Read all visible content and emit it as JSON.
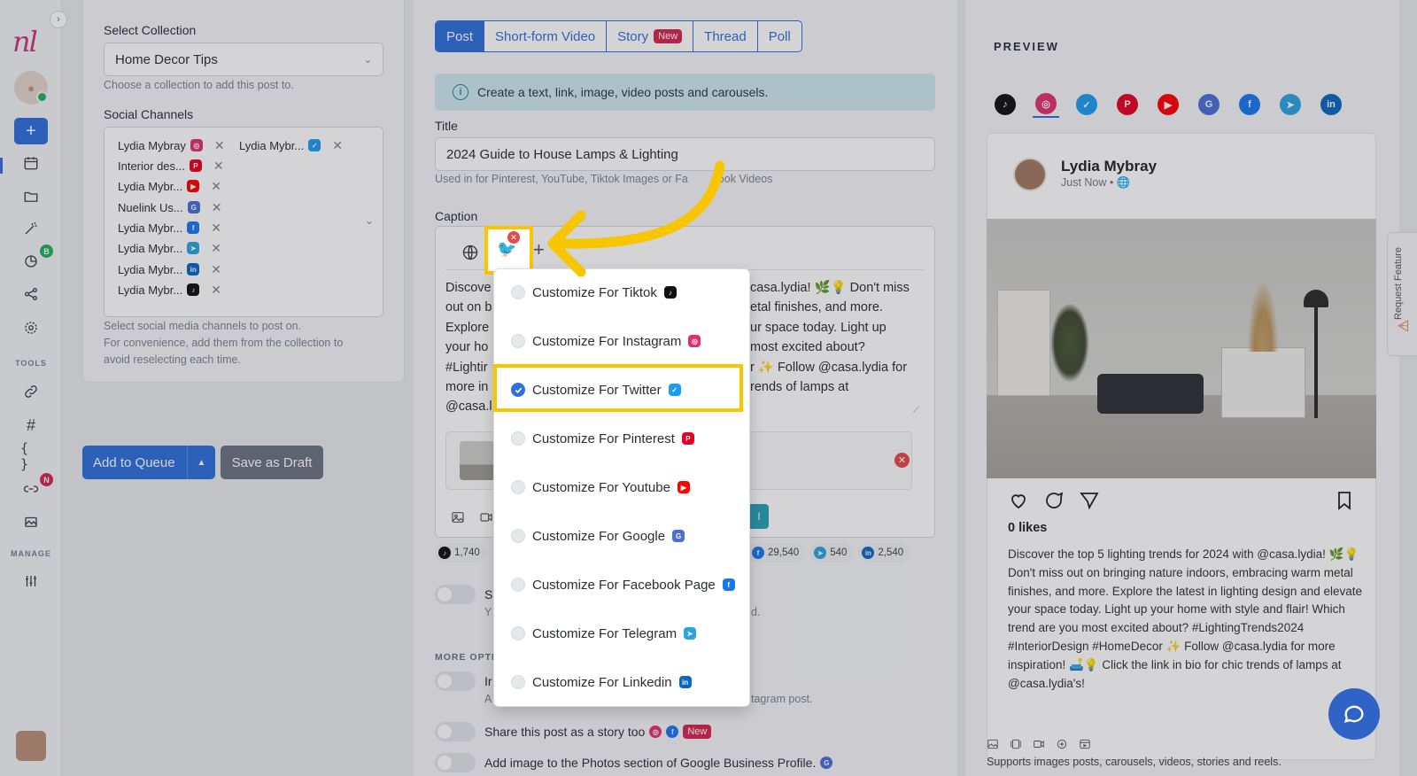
{
  "rail": {
    "sections": {
      "tools": "TOOLS",
      "manage": "MANAGE"
    },
    "badges": {
      "analytics": "B",
      "links": "N"
    }
  },
  "settings": {
    "collection_label": "Select Collection",
    "collection_value": "Home Decor Tips",
    "collection_hint": "Choose a collection to add this post to.",
    "channels_label": "Social Channels",
    "channels": [
      {
        "name": "Lydia Mybray",
        "icon": "instagram-icon",
        "color": "#e1306c"
      },
      {
        "name": "Lydia Mybr...",
        "icon": "twitter-icon",
        "color": "#1d9bf0"
      },
      {
        "name": "Interior des...",
        "icon": "pinterest-icon",
        "color": "#e60023"
      },
      {
        "name": "Lydia Mybr...",
        "icon": "youtube-icon",
        "color": "#ff0000"
      },
      {
        "name": "Nuelink Us...",
        "icon": "google-business-icon",
        "color": "#4a6fd6"
      },
      {
        "name": "Lydia Mybr...",
        "icon": "facebook-icon",
        "color": "#1877f2"
      },
      {
        "name": "Lydia Mybr...",
        "icon": "telegram-icon",
        "color": "#2aa3df"
      },
      {
        "name": "Lydia Mybr...",
        "icon": "linkedin-icon",
        "color": "#0a66c2"
      },
      {
        "name": "Lydia Mybr...",
        "icon": "tiktok-icon",
        "color": "#111111"
      }
    ],
    "channels_hint": [
      "Select social media channels to post on.",
      "For convenience, add them from the collection to",
      "avoid reselecting each time."
    ],
    "add_to_queue": "Add to Queue",
    "save_draft": "Save as Draft"
  },
  "composer": {
    "tabs": [
      {
        "label": "Post",
        "active": true
      },
      {
        "label": "Short-form Video",
        "active": false
      },
      {
        "label": "Story",
        "active": false,
        "badge": "New"
      },
      {
        "label": "Thread",
        "active": false
      },
      {
        "label": "Poll",
        "active": false
      }
    ],
    "info": "Create a text, link, image, video posts and carousels.",
    "title_label": "Title",
    "title_value": "2024 Guide to House Lamps & Lighting",
    "title_hint": "Used in for Pinterest, YouTube, Tiktok Images or Fa",
    "title_hint_end": "ook Videos",
    "caption_label": "Caption",
    "caption_left": [
      "Discove",
      "out on b",
      "Explore",
      "your ho",
      "#Lightir",
      "more in",
      "@casa.l"
    ],
    "caption_right": [
      "casa.lydia! 🌿💡 Don't miss",
      "etal finishes, and more.",
      "ur space today. Light up",
      "most excited about?",
      "r ✨ Follow @casa.lydia for",
      "rends of lamps at",
      ""
    ],
    "counts": [
      {
        "icon": "tiktok-icon",
        "value": "1,740",
        "color": "#111111"
      },
      {
        "icon": "facebook-icon",
        "value": "29,540",
        "color": "#1877f2"
      },
      {
        "icon": "telegram-icon",
        "value": "540",
        "color": "#2aa3df"
      },
      {
        "icon": "linkedin-icon",
        "value": "2,540",
        "color": "#0a66c2"
      }
    ],
    "more_options": "MORE OPTI",
    "opt_partial": [
      "S",
      "Y",
      "d.",
      "Ir",
      "A",
      "tagram post."
    ],
    "story_toggle": "Share this post as a story too",
    "story_badge": "New",
    "gbp_toggle": "Add image to the Photos section of Google Business Profile."
  },
  "dropdown": {
    "items": [
      {
        "label": "Customize For Tiktok",
        "checked": false,
        "icon": "tiktok-icon",
        "color": "#111111"
      },
      {
        "label": "Customize For Instagram",
        "checked": false,
        "icon": "instagram-icon",
        "color": "#e1306c"
      },
      {
        "label": "Customize For Twitter",
        "checked": true,
        "icon": "twitter-icon",
        "color": "#1d9bf0"
      },
      {
        "label": "Customize For Pinterest",
        "checked": false,
        "icon": "pinterest-icon",
        "color": "#e60023"
      },
      {
        "label": "Customize For Youtube",
        "checked": false,
        "icon": "youtube-icon",
        "color": "#ff0000"
      },
      {
        "label": "Customize For Google",
        "checked": false,
        "icon": "google-business-icon",
        "color": "#4a6fd6"
      },
      {
        "label": "Customize For Facebook Page",
        "checked": false,
        "icon": "facebook-icon",
        "color": "#1877f2"
      },
      {
        "label": "Customize For Telegram",
        "checked": false,
        "icon": "telegram-icon",
        "color": "#2aa3df"
      },
      {
        "label": "Customize For Linkedin",
        "checked": false,
        "icon": "linkedin-icon",
        "color": "#0a66c2"
      }
    ]
  },
  "preview": {
    "title": "PREVIEW",
    "networks": [
      {
        "icon": "tiktok-icon",
        "color": "#111111"
      },
      {
        "icon": "instagram-icon",
        "color": "#e1306c",
        "selected": true
      },
      {
        "icon": "twitter-icon",
        "color": "#1d9bf0"
      },
      {
        "icon": "pinterest-icon",
        "color": "#e60023"
      },
      {
        "icon": "youtube-icon",
        "color": "#ff0000"
      },
      {
        "icon": "google-business-icon",
        "color": "#4a6fd6"
      },
      {
        "icon": "facebook-icon",
        "color": "#1877f2"
      },
      {
        "icon": "telegram-icon",
        "color": "#2aa3df"
      },
      {
        "icon": "linkedin-icon",
        "color": "#0a66c2"
      }
    ],
    "author": "Lydia Mybray",
    "time": "Just Now • 🌐",
    "likes": "0 likes",
    "body": "Discover the top 5 lighting trends for 2024 with @casa.lydia! 🌿💡 Don't miss out on bringing nature indoors, embracing warm metal finishes, and more. Explore the latest in lighting design and elevate your space today. Light up your home with style and flair! Which trend are you most excited about? #LightingTrends2024 #InteriorDesign #HomeDecor ✨ Follow @casa.lydia for more inspiration! 🛋️💡 Click the link in bio for chic trends of lamps at @casa.lydia's!",
    "supports": "Supports images posts, carousels, videos, stories and reels.",
    "request_feature": "Request Feature"
  },
  "colors": {
    "accent": "#2f6fdb",
    "highlight": "#f7c600"
  }
}
